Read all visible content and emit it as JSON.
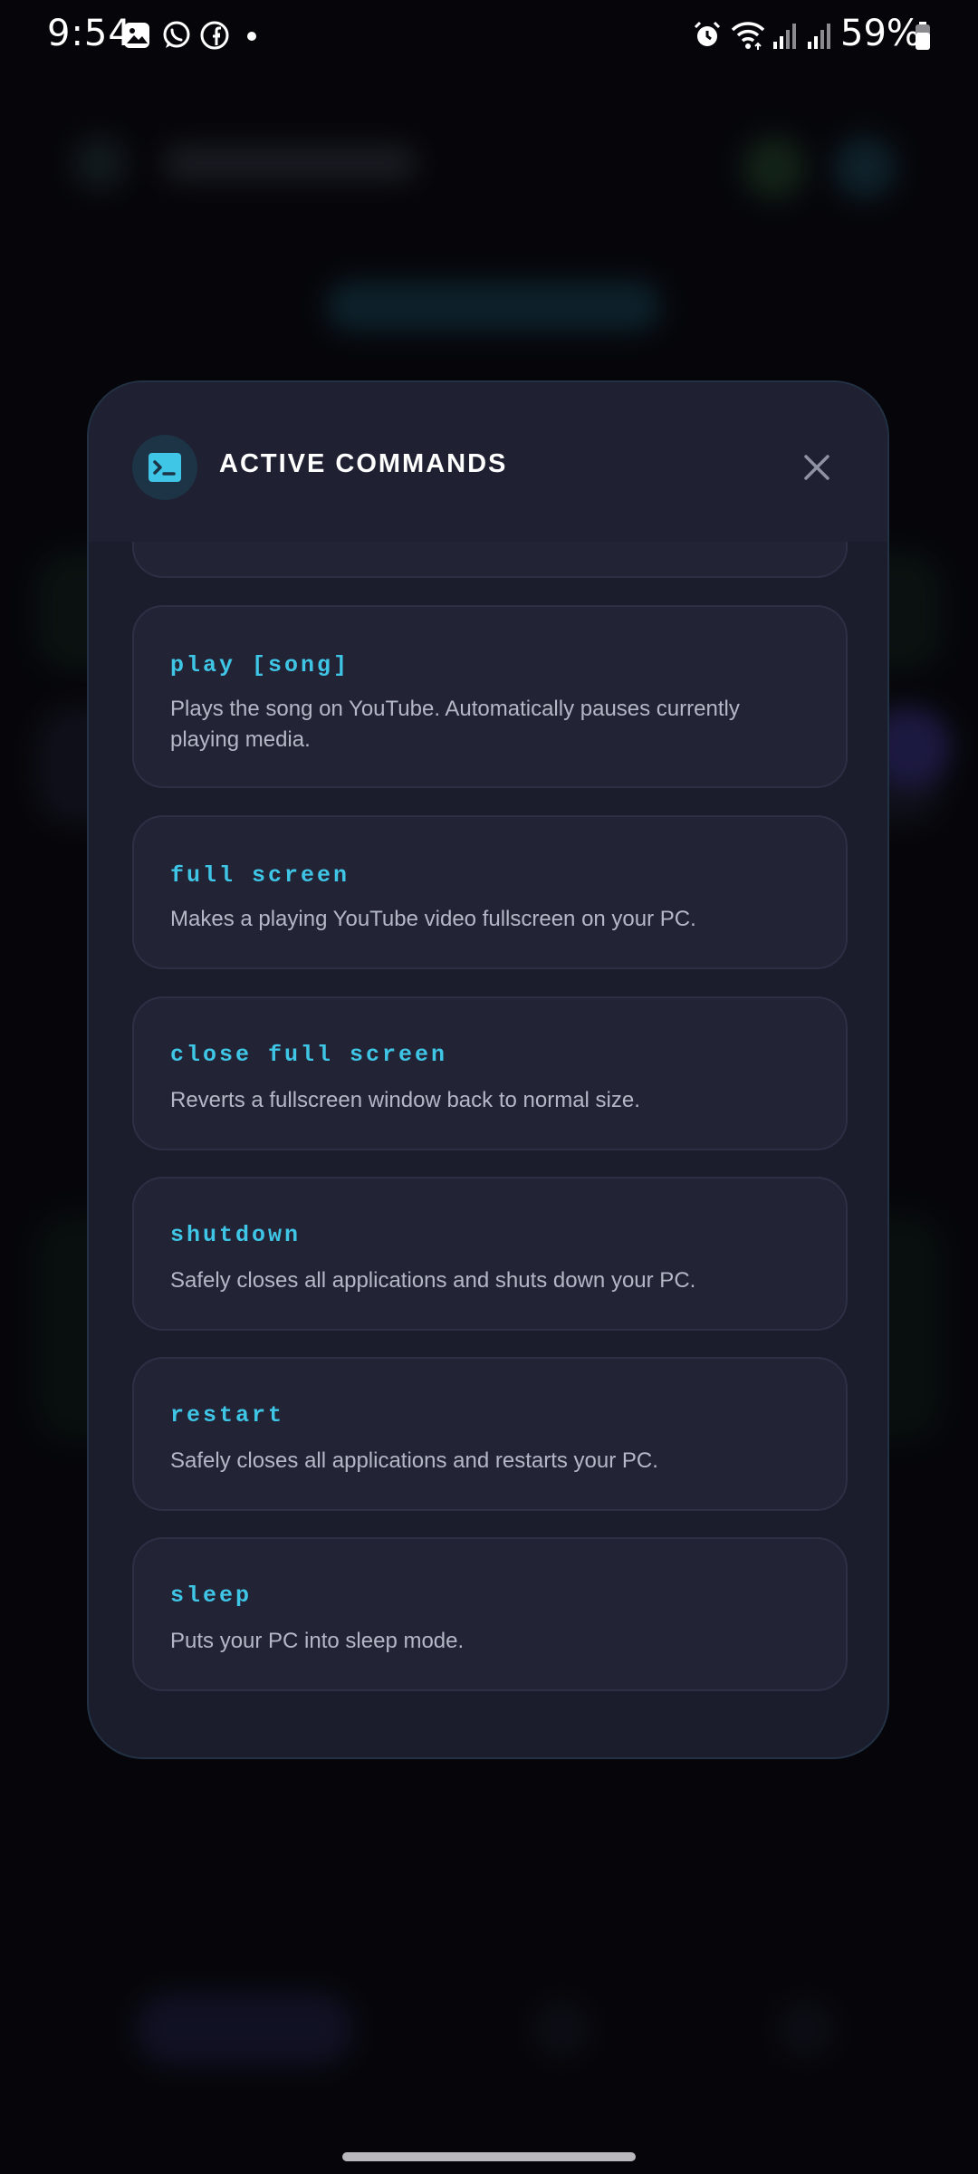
{
  "status_bar": {
    "time": "9:54",
    "battery_percent": "59%",
    "left_icons": [
      "gallery-icon",
      "whatsapp-icon",
      "facebook-icon",
      "notification-dot"
    ],
    "right_icons": [
      "alarm-icon",
      "wifi-icon",
      "signal-icon",
      "signal-icon",
      "battery-icon"
    ]
  },
  "modal": {
    "title": "ACTIVE COMMANDS",
    "icon": "terminal-icon",
    "close_icon": "close-icon",
    "commands": [
      {
        "command": "play [song]",
        "description": "Plays the song on YouTube. Automatically pauses currently playing media."
      },
      {
        "command": "full screen",
        "description": "Makes a playing YouTube video fullscreen on your PC."
      },
      {
        "command": "close full screen",
        "description": "Reverts a fullscreen window back to normal size."
      },
      {
        "command": "shutdown",
        "description": "Safely closes all applications and shuts down your PC."
      },
      {
        "command": "restart",
        "description": "Safely closes all applications and restarts your PC."
      },
      {
        "command": "sleep",
        "description": "Puts your PC into sleep mode."
      }
    ]
  },
  "colors": {
    "accent": "#3fc6e6",
    "modal_bg": "#1b1c2c",
    "card_bg": "#222436",
    "page_bg": "#07070c"
  }
}
